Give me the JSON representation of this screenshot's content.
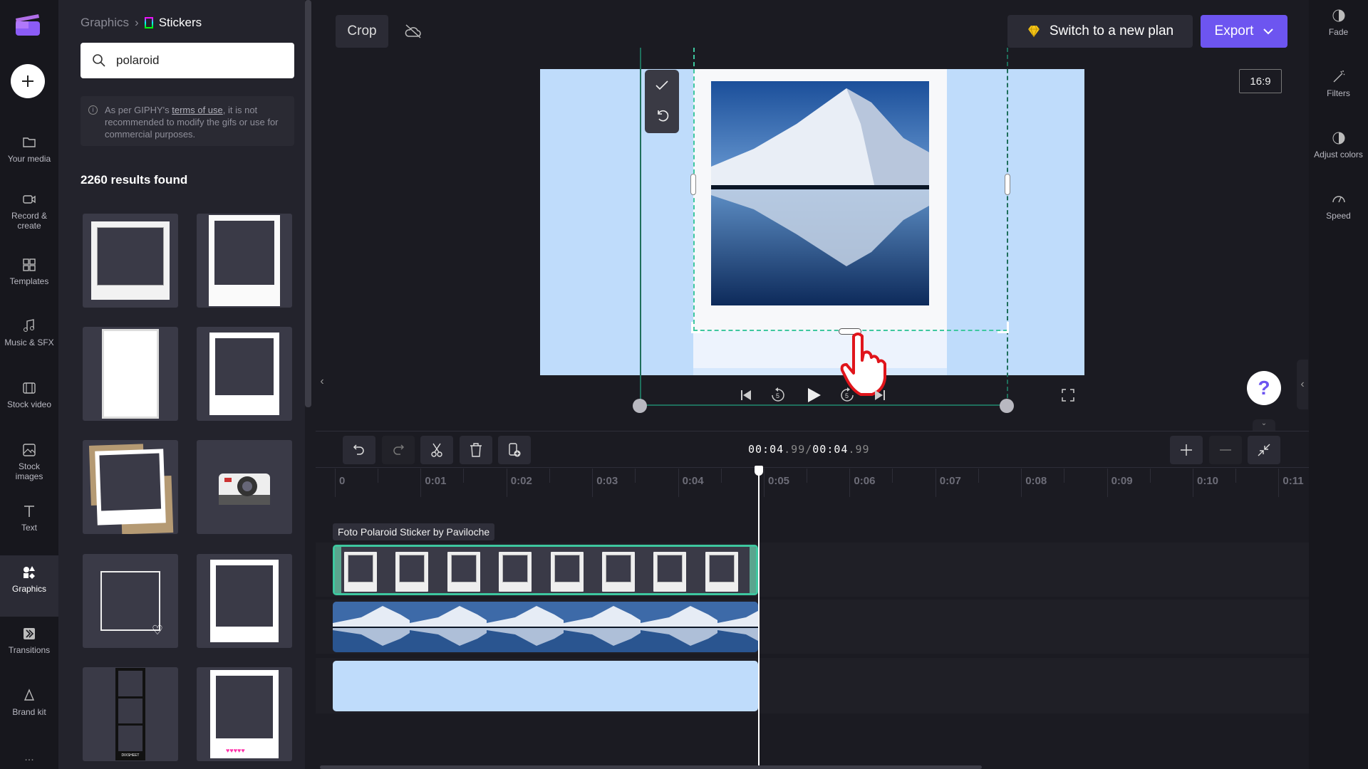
{
  "rail": {
    "items": [
      {
        "label": "Your media",
        "icon": "folder-icon"
      },
      {
        "label": "Record & create",
        "icon": "camera-icon"
      },
      {
        "label": "Templates",
        "icon": "templates-icon"
      },
      {
        "label": "Music & SFX",
        "icon": "music-icon"
      },
      {
        "label": "Stock video",
        "icon": "film-icon"
      },
      {
        "label": "Stock images",
        "icon": "image-icon"
      },
      {
        "label": "Text",
        "icon": "text-icon"
      },
      {
        "label": "Graphics",
        "icon": "shapes-icon",
        "active": true
      },
      {
        "label": "Transitions",
        "icon": "transitions-icon"
      },
      {
        "label": "Brand kit",
        "icon": "brand-icon"
      }
    ],
    "more": "..."
  },
  "panel": {
    "breadcrumb_parent": "Graphics",
    "breadcrumb_current": "Stickers",
    "search_value": "polaroid",
    "notice_pre": "As per GIPHY's ",
    "notice_link": "terms of use",
    "notice_post": ", it is not recommended to modify the gifs or use for commercial purposes.",
    "results": "2260 results found",
    "credit": "DIXSHEET"
  },
  "toolbar": {
    "crop": "Crop",
    "upgrade": "Switch to a new plan",
    "export": "Export"
  },
  "preview": {
    "aspect": "16:9",
    "bg_color": "#bfdcfb"
  },
  "timeline": {
    "current": "00:04",
    "current_frac": ".99",
    "sep": "/",
    "total": "00:04",
    "total_frac": ".99",
    "ticks": [
      "0",
      "0:01",
      "0:02",
      "0:03",
      "0:04",
      "0:05",
      "0:06",
      "0:07",
      "0:08",
      "0:09",
      "0:10",
      "0:11"
    ],
    "clip_label": "Foto Polaroid Sticker by Paviloche",
    "accent": "#3ec79f"
  },
  "right_rail": [
    {
      "label": "Fade"
    },
    {
      "label": "Filters"
    },
    {
      "label": "Adjust colors"
    },
    {
      "label": "Speed"
    }
  ]
}
